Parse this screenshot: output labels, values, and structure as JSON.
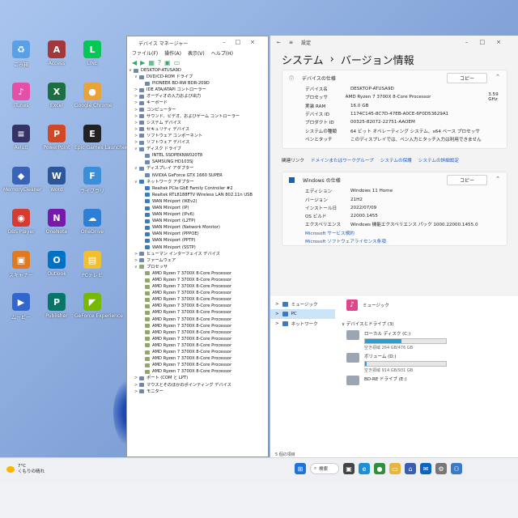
{
  "desktop_icons": [
    {
      "label": "ごみ箱",
      "color": "#5aa0e6",
      "glyph": "♻"
    },
    {
      "label": "Access",
      "color": "#a4373a",
      "glyph": "A"
    },
    {
      "label": "LINE",
      "color": "#06c755",
      "glyph": "L"
    },
    {
      "label": "iTunes",
      "color": "#e64fa8",
      "glyph": "♪"
    },
    {
      "label": "Excel",
      "color": "#1d6f42",
      "glyph": "X"
    },
    {
      "label": "Google Chrome",
      "color": "#e8a33b",
      "glyph": "●"
    },
    {
      "label": "Aviutl",
      "color": "#333366",
      "glyph": "≡"
    },
    {
      "label": "PowerPoint",
      "color": "#d24726",
      "glyph": "P"
    },
    {
      "label": "Epic Games Launcher",
      "color": "#222222",
      "glyph": "E"
    },
    {
      "label": "MemoryCleaner",
      "color": "#3a62b5",
      "glyph": "◆"
    },
    {
      "label": "Word",
      "color": "#2b579a",
      "glyph": "W"
    },
    {
      "label": "ライブラリ",
      "color": "#3b8fd9",
      "glyph": "F"
    },
    {
      "label": "OBS Player",
      "color": "#d63b2f",
      "glyph": "◉"
    },
    {
      "label": "OneNote",
      "color": "#7719aa",
      "glyph": "N"
    },
    {
      "label": "OneDrive",
      "color": "#2d7fd6",
      "glyph": "☁"
    },
    {
      "label": "スキャナー",
      "color": "#e07a1f",
      "glyph": "▣"
    },
    {
      "label": "Outlook",
      "color": "#0072c6",
      "glyph": "O"
    },
    {
      "label": "PCテレビ",
      "color": "#f0c030",
      "glyph": "▤"
    },
    {
      "label": "ムービー",
      "color": "#3366cc",
      "glyph": "▶"
    },
    {
      "label": "Publisher",
      "color": "#077568",
      "glyph": "P"
    },
    {
      "label": "GeForce Experience",
      "color": "#76b900",
      "glyph": "◤"
    }
  ],
  "device_manager": {
    "title": "デバイス マネージャー",
    "menu": [
      "ファイル(F)",
      "操作(A)",
      "表示(V)",
      "ヘルプ(H)"
    ],
    "tree": [
      {
        "label": "DESKTOP-ATUSA9D",
        "level": 0,
        "glyph": "∨",
        "kind": "pc"
      },
      {
        "label": "DVD/CD-ROM ドライブ",
        "level": 1,
        "glyph": "∨",
        "kind": "dev"
      },
      {
        "label": "PIONEER BD-RW BDR-209D",
        "level": 2,
        "glyph": "",
        "kind": "dev"
      },
      {
        "label": "IDE ATA/ATAPI コントローラー",
        "level": 1,
        "glyph": ">",
        "kind": "dev"
      },
      {
        "label": "オーディオの入力および出力",
        "level": 1,
        "glyph": ">",
        "kind": "dev"
      },
      {
        "label": "キーボード",
        "level": 1,
        "glyph": ">",
        "kind": "dev"
      },
      {
        "label": "コンピューター",
        "level": 1,
        "glyph": ">",
        "kind": "dev"
      },
      {
        "label": "サウンド、ビデオ、およびゲーム コントローラー",
        "level": 1,
        "glyph": ">",
        "kind": "dev"
      },
      {
        "label": "システム デバイス",
        "level": 1,
        "glyph": ">",
        "kind": "dev"
      },
      {
        "label": "セキュリティ デバイス",
        "level": 1,
        "glyph": ">",
        "kind": "dev"
      },
      {
        "label": "ソフトウェア コンポーネント",
        "level": 1,
        "glyph": ">",
        "kind": "dev"
      },
      {
        "label": "ソフトウェア デバイス",
        "level": 1,
        "glyph": ">",
        "kind": "dev"
      },
      {
        "label": "ディスク ドライブ",
        "level": 1,
        "glyph": "∨",
        "kind": "dev"
      },
      {
        "label": "INTEL SSDPEKNW020T8",
        "level": 2,
        "glyph": "",
        "kind": "dev"
      },
      {
        "label": "SAMSUNG HD103SJ",
        "level": 2,
        "glyph": "",
        "kind": "dev"
      },
      {
        "label": "ディスプレイ アダプター",
        "level": 1,
        "glyph": "∨",
        "kind": "dev"
      },
      {
        "label": "NVIDIA GeForce GTX 1660 SUPER",
        "level": 2,
        "glyph": "",
        "kind": "dev"
      },
      {
        "label": "ネットワーク アダプター",
        "level": 1,
        "glyph": "∨",
        "kind": "net"
      },
      {
        "label": "Realtek PCIe GbE Family Controller #2",
        "level": 2,
        "glyph": "",
        "kind": "net"
      },
      {
        "label": "Realtek RTL8188FTV Wireless LAN 802.11n USB",
        "level": 2,
        "glyph": "",
        "kind": "net"
      },
      {
        "label": "WAN Miniport (IKEv2)",
        "level": 2,
        "glyph": "",
        "kind": "net"
      },
      {
        "label": "WAN Miniport (IP)",
        "level": 2,
        "glyph": "",
        "kind": "net"
      },
      {
        "label": "WAN Miniport (IPv6)",
        "level": 2,
        "glyph": "",
        "kind": "net"
      },
      {
        "label": "WAN Miniport (L2TP)",
        "level": 2,
        "glyph": "",
        "kind": "net"
      },
      {
        "label": "WAN Miniport (Network Monitor)",
        "level": 2,
        "glyph": "",
        "kind": "net"
      },
      {
        "label": "WAN Miniport (PPPOE)",
        "level": 2,
        "glyph": "",
        "kind": "net"
      },
      {
        "label": "WAN Miniport (PPTP)",
        "level": 2,
        "glyph": "",
        "kind": "net"
      },
      {
        "label": "WAN Miniport (SSTP)",
        "level": 2,
        "glyph": "",
        "kind": "net"
      },
      {
        "label": "ヒューマン インターフェイス デバイス",
        "level": 1,
        "glyph": ">",
        "kind": "dev"
      },
      {
        "label": "ファームウェア",
        "level": 1,
        "glyph": ">",
        "kind": "dev"
      },
      {
        "label": "プロセッサ",
        "level": 1,
        "glyph": "∨",
        "kind": "cpu"
      },
      {
        "label": "AMD Ryzen 7 3700X 8-Core Processor",
        "level": 2,
        "glyph": "",
        "kind": "cpu"
      },
      {
        "label": "AMD Ryzen 7 3700X 8-Core Processor",
        "level": 2,
        "glyph": "",
        "kind": "cpu"
      },
      {
        "label": "AMD Ryzen 7 3700X 8-Core Processor",
        "level": 2,
        "glyph": "",
        "kind": "cpu"
      },
      {
        "label": "AMD Ryzen 7 3700X 8-Core Processor",
        "level": 2,
        "glyph": "",
        "kind": "cpu"
      },
      {
        "label": "AMD Ryzen 7 3700X 8-Core Processor",
        "level": 2,
        "glyph": "",
        "kind": "cpu"
      },
      {
        "label": "AMD Ryzen 7 3700X 8-Core Processor",
        "level": 2,
        "glyph": "",
        "kind": "cpu"
      },
      {
        "label": "AMD Ryzen 7 3700X 8-Core Processor",
        "level": 2,
        "glyph": "",
        "kind": "cpu"
      },
      {
        "label": "AMD Ryzen 7 3700X 8-Core Processor",
        "level": 2,
        "glyph": "",
        "kind": "cpu"
      },
      {
        "label": "AMD Ryzen 7 3700X 8-Core Processor",
        "level": 2,
        "glyph": "",
        "kind": "cpu"
      },
      {
        "label": "AMD Ryzen 7 3700X 8-Core Processor",
        "level": 2,
        "glyph": "",
        "kind": "cpu"
      },
      {
        "label": "AMD Ryzen 7 3700X 8-Core Processor",
        "level": 2,
        "glyph": "",
        "kind": "cpu"
      },
      {
        "label": "AMD Ryzen 7 3700X 8-Core Processor",
        "level": 2,
        "glyph": "",
        "kind": "cpu"
      },
      {
        "label": "AMD Ryzen 7 3700X 8-Core Processor",
        "level": 2,
        "glyph": "",
        "kind": "cpu"
      },
      {
        "label": "AMD Ryzen 7 3700X 8-Core Processor",
        "level": 2,
        "glyph": "",
        "kind": "cpu"
      },
      {
        "label": "AMD Ryzen 7 3700X 8-Core Processor",
        "level": 2,
        "glyph": "",
        "kind": "cpu"
      },
      {
        "label": "AMD Ryzen 7 3700X 8-Core Processor",
        "level": 2,
        "glyph": "",
        "kind": "cpu"
      },
      {
        "label": "ポート (COM と LPT)",
        "level": 1,
        "glyph": ">",
        "kind": "dev"
      },
      {
        "label": "マウスとそのほかのポインティング デバイス",
        "level": 1,
        "glyph": ">",
        "kind": "dev"
      },
      {
        "label": "モニター",
        "level": 1,
        "glyph": ">",
        "kind": "dev"
      }
    ]
  },
  "settings": {
    "title": "設定",
    "breadcrumb_root": "システム",
    "breadcrumb_sep": "›",
    "breadcrumb_page": "バージョン情報",
    "device_spec": {
      "heading": "デバイスの仕様",
      "copy_label": "コピー",
      "rows": [
        {
          "k": "デバイス名",
          "v": "DESKTOP-ATUSA9D",
          "v2": ""
        },
        {
          "k": "プロセッサ",
          "v": "AMD Ryzen 7 3700X 8-Core Processor",
          "v2": "3.59 GHz"
        },
        {
          "k": "実装 RAM",
          "v": "16.0 GB",
          "v2": ""
        },
        {
          "k": "デバイス ID",
          "v": "1174C145-8C7D-47EB-A0CE-6F0D53629A1",
          "v2": ""
        },
        {
          "k": "プロダクト ID",
          "v": "00325-82072-22751-AAOEM",
          "v2": ""
        },
        {
          "k": "システムの種類",
          "v": "64 ビット オペレーティング システム、x64 ベース プロセッサ",
          "v2": ""
        },
        {
          "k": "ペンとタッチ",
          "v": "このディスプレイでは、ペン入力とタッチ入力は利用できません",
          "v2": ""
        }
      ]
    },
    "related": {
      "label": "関連リンク",
      "links": [
        "ドメインまたはワークグループ",
        "システムの保護",
        "システムの詳細設定"
      ]
    },
    "windows_spec": {
      "heading": "Windows の仕様",
      "copy_label": "コピー",
      "rows": [
        {
          "k": "エディション",
          "v": "Windows 11 Home"
        },
        {
          "k": "バージョン",
          "v": "21H2"
        },
        {
          "k": "インストール日",
          "v": "2022/07/09"
        },
        {
          "k": "OS ビルド",
          "v": "22000.1455"
        },
        {
          "k": "エクスペリエンス",
          "v": "Windows 機能エクスペリエンス パック 1000.22000.1455.0"
        }
      ],
      "link1": "Microsoft サービス規約",
      "link2": "Microsoft ソフトウェアライセンス条項"
    }
  },
  "explorer": {
    "side": [
      {
        "label": "ミュージック",
        "sel": false
      },
      {
        "label": "PC",
        "sel": true
      },
      {
        "label": "ネットワーク",
        "sel": false
      }
    ],
    "music_label": "ミュージック",
    "section": "デバイスとドライブ (3)",
    "drives": [
      {
        "name": "ローカル ディスク (C:)",
        "free": "空き領域 264 GB/476 GB",
        "fill": 0.45
      },
      {
        "name": "ボリューム (D:)",
        "free": "空き領域 914 GB/931 GB",
        "fill": 0.02
      },
      {
        "name": "BD-RE ドライブ (E:)",
        "free": "",
        "fill": null
      }
    ],
    "status": "5 個の項目"
  },
  "taskbar": {
    "temp": "7°C",
    "weather": "くもりの晴れ",
    "search": "検索"
  }
}
